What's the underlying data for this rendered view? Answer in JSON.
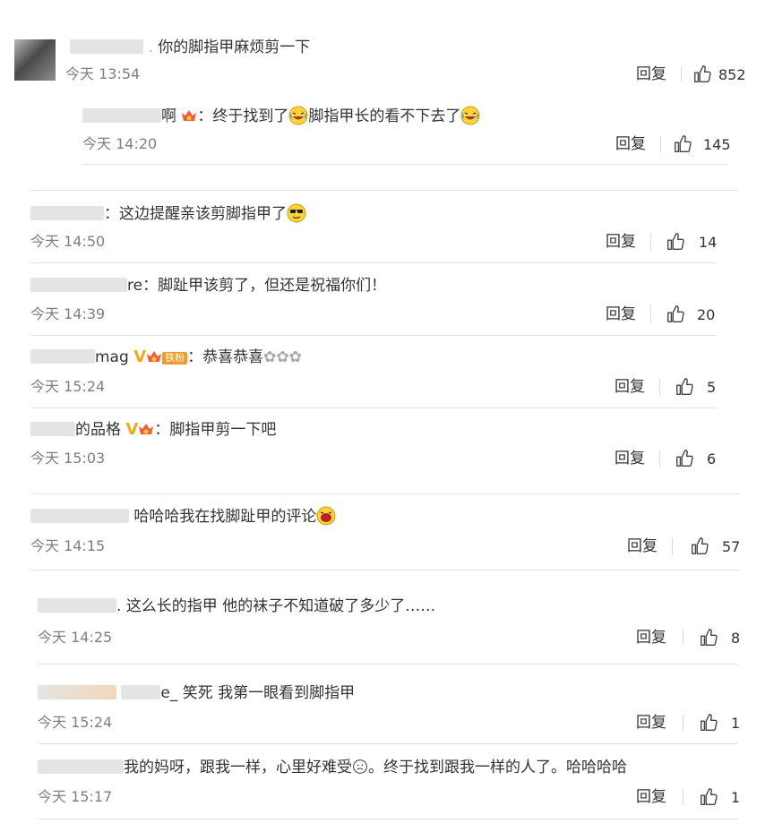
{
  "ui": {
    "reply_label": "回复"
  },
  "comments": [
    {
      "user_visible": ".",
      "text": "你的脚指甲麻烦剪一下",
      "time": "今天 13:54",
      "likes": "852"
    },
    {
      "user_visible": "啊",
      "text": "：终于找到了",
      "text2": "脚指甲长的看不下去了",
      "time": "今天 14:20",
      "likes": "145"
    },
    {
      "user_visible": "",
      "text": "：这边提醒亲该剪脚指甲了",
      "time": "今天 14:50",
      "likes": "14"
    },
    {
      "user_visible": "re",
      "text": "：脚趾甲该剪了，但还是祝福你们！",
      "time": "今天 14:39",
      "likes": "20"
    },
    {
      "user_visible": "mag",
      "fan_badge": "铁粉",
      "text": "：恭喜恭喜",
      "time": "今天 15:24",
      "likes": "5"
    },
    {
      "user_visible": "的品格",
      "text": "：脚指甲剪一下吧",
      "time": "今天 15:03",
      "likes": "6"
    },
    {
      "user_visible": "",
      "text": "哈哈哈我在找脚趾甲的评论",
      "time": "今天 14:15",
      "likes": "57"
    },
    {
      "user_visible": ".",
      "text": "这么长的指甲 他的袜子不知道破了多少了……",
      "time": "今天 14:25",
      "likes": "8"
    },
    {
      "user_visible": "e_",
      "text": "笑死 我第一眼看到脚指甲",
      "time": "今天 15:24",
      "likes": "1"
    },
    {
      "user_visible": "",
      "text": "我的妈呀，跟我一样，心里好难受",
      "text2": "。终于找到跟我一样的人了。哈哈哈哈",
      "time": "今天 15:17",
      "likes": "1"
    }
  ],
  "icons": {
    "like": "thumbs-up-icon",
    "vip_crown": "crown-icon",
    "verified": "v-badge-icon"
  },
  "colors": {
    "text": "#333333",
    "time": "#7f7f7f",
    "divider": "#e2e2e2",
    "badge": "#f0a81f"
  }
}
